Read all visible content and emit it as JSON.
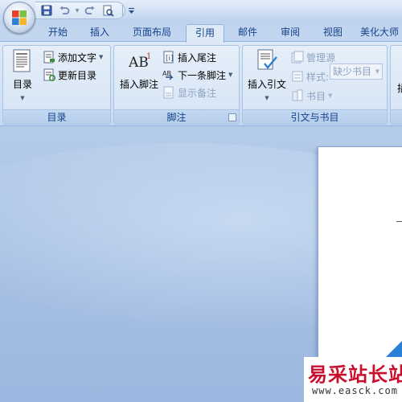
{
  "quick_access": {
    "icons": [
      "save-icon",
      "undo-icon",
      "redo-icon",
      "print-preview-icon",
      "customize-arrow-icon"
    ]
  },
  "tabs": [
    {
      "label": "开始",
      "active": false
    },
    {
      "label": "插入",
      "active": false
    },
    {
      "label": "页面布局",
      "active": false
    },
    {
      "label": "引用",
      "active": true
    },
    {
      "label": "邮件",
      "active": false
    },
    {
      "label": "审阅",
      "active": false
    },
    {
      "label": "视图",
      "active": false
    },
    {
      "label": "美化大师",
      "active": false
    }
  ],
  "groups": {
    "toc": {
      "label": "目录",
      "big_button": "目录",
      "add_text": "添加文字",
      "update_toc": "更新目录"
    },
    "footnotes": {
      "label": "脚注",
      "insert_footnote": "插入脚注",
      "insert_endnote": "插入尾注",
      "next_footnote": "下一条脚注",
      "show_notes": "显示备注"
    },
    "citations": {
      "label": "引文与书目",
      "insert_citation": "插入引文",
      "manage_sources": "管理源",
      "style": "样式:",
      "style_value": "缺少书目",
      "bibliography": "书目"
    },
    "next_group": {
      "button": "插"
    }
  },
  "watermark": {
    "text": "易采站长站",
    "url": "www.easck.com"
  },
  "colors": {
    "accent": "#15428b",
    "watermark_red": "#c8102e"
  }
}
